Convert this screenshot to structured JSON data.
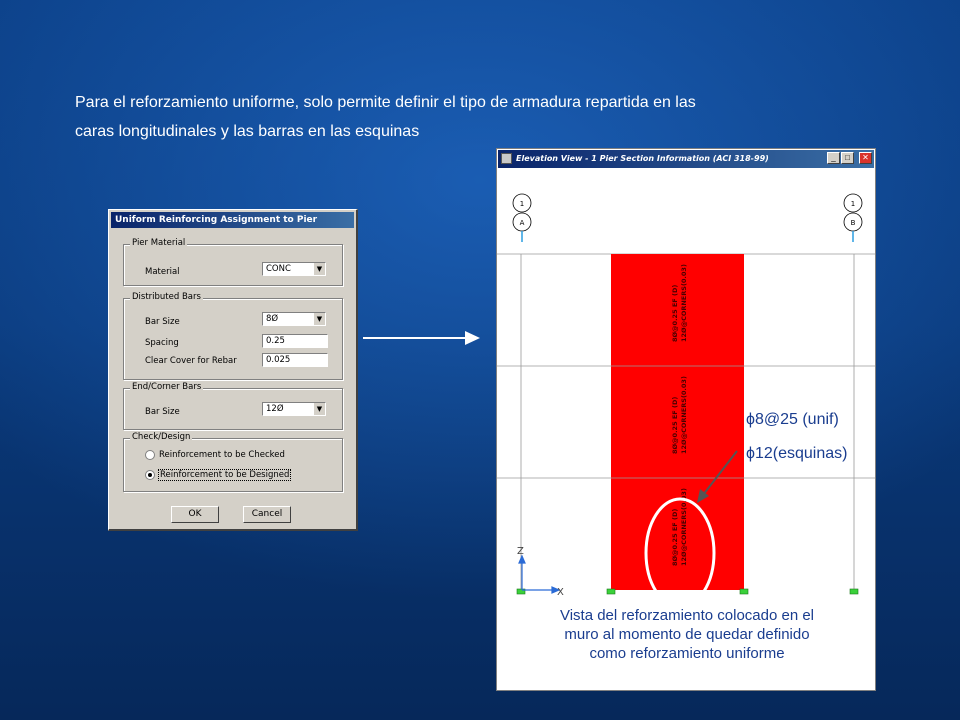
{
  "slide": {
    "text_line1": "Para el reforzamiento uniforme, solo permite definir el tipo de armadura repartida en las",
    "text_line2": "caras longitudinales y las barras en las esquinas"
  },
  "dialog": {
    "title": "Uniform Reinforcing Assignment to Pier",
    "pier_material": {
      "legend": "Pier Material",
      "material_label": "Material",
      "material_value": "CONC"
    },
    "distributed_bars": {
      "legend": "Distributed Bars",
      "bar_size_label": "Bar Size",
      "bar_size_value": "8Ø",
      "spacing_label": "Spacing",
      "spacing_value": "0.25",
      "clear_cover_label": "Clear Cover for Rebar",
      "clear_cover_value": "0.025"
    },
    "end_corner_bars": {
      "legend": "End/Corner Bars",
      "bar_size_label": "Bar Size",
      "bar_size_value": "12Ø"
    },
    "check_design": {
      "legend": "Check/Design",
      "option_checked": "Reinforcement to be Checked",
      "option_designed": "Reinforcement to be Designed",
      "selected": "designed"
    },
    "ok_label": "OK",
    "cancel_label": "Cancel"
  },
  "elevation_window": {
    "title": "Elevation View - 1  Pier Section Information  (ACI 318-99)",
    "grid_left_top": "1",
    "grid_left_bottom": "A",
    "grid_right_top": "1",
    "grid_right_bottom": "B",
    "pier_label_line1": "8Ø@0.25 EF (D)",
    "pier_label_line2": "12Ø@CORNERS(0.03)",
    "axis_z": "Z",
    "axis_x": "X",
    "pier_color": "#ff0000"
  },
  "annotations": {
    "distributed": "ϕ8@25 (unif)",
    "corners": "ϕ12(esquinas)"
  },
  "caption": {
    "line1": "Vista del reforzamiento colocado en el",
    "line2": "muro al momento de quedar definido",
    "line3": "como reforzamiento uniforme"
  }
}
